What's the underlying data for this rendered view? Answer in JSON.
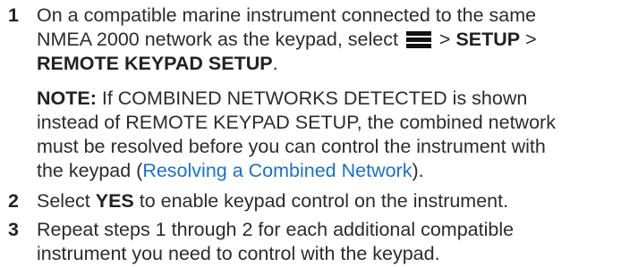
{
  "steps": [
    {
      "number": "1",
      "line1": "On a compatible marine instrument connected to the same",
      "line2_pre": "NMEA 2000 network as the keypad, select",
      "sep1": " > ",
      "setup": "SETUP",
      "sep2": " >",
      "remote_setup": "REMOTE KEYPAD SETUP",
      "period": ".",
      "icon": "menu-icon",
      "note": {
        "label": "NOTE:",
        "line1_rest": " If COMBINED NETWORKS DETECTED is shown",
        "line2": "instead of REMOTE KEYPAD SETUP, the combined network",
        "line3": "must be resolved before you can control the instrument with",
        "line4_pre": "the keypad (",
        "link": "Resolving a Combined Network",
        "line4_post": ")."
      }
    },
    {
      "number": "2",
      "pre": "Select ",
      "bold": "YES",
      "post": " to enable keypad control on the instrument."
    },
    {
      "number": "3",
      "line1": "Repeat steps 1 through 2 for each additional compatible",
      "line2": "instrument you need to control with the keypad."
    }
  ]
}
